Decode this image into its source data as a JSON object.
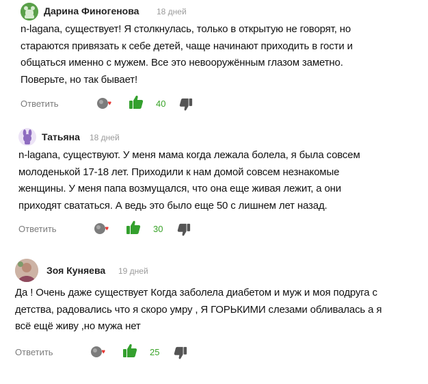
{
  "colors": {
    "like": "#34a02e",
    "count": "#3aa329",
    "muted": "#7b7b7b",
    "date": "#9a9a9a"
  },
  "comments": [
    {
      "author": "Дарина Финогенова",
      "date": "18 дней",
      "avatar_icon": "green-bear-avatar-icon",
      "lines": [
        "n-lagana, существует! Я столкнулась, только в открытую не говорят, но",
        "стараются привязать к себе детей, чаще начинают приходить в гости и",
        "общаться именно с мужем. Все это невооружённым глазом заметно.",
        "Поверьте, но так бывает!"
      ],
      "reply_label": "Ответить",
      "likes": "40"
    },
    {
      "author": "Татьяна",
      "date": "18 дней",
      "avatar_icon": "purple-rabbit-avatar-icon",
      "lines": [
        "n-lagana, существуют. У меня мама когда лежала болела, я была совсем",
        "молоденькой 17-18 лет. Приходили к нам домой совсем незнакомые",
        "женщины. У меня папа возмущался, что она еще живая лежит, а они",
        "приходят свататься. А ведь это было еще 50 с лишнем лет назад."
      ],
      "reply_label": "Ответить",
      "likes": "30"
    },
    {
      "author": "Зоя Куняева",
      "date": "19 дней",
      "avatar_icon": "user-photo-avatar",
      "lines": [
        "Да ! Очень даже существует Когда заболела диабетом и муж и моя подруга с",
        "детства, радовались что я скоро умру , Я ГОРЬКИМИ слезами обливалась а я",
        "всё ещё живу ,но мужа нет"
      ],
      "reply_label": "Ответить",
      "likes": "25"
    }
  ]
}
